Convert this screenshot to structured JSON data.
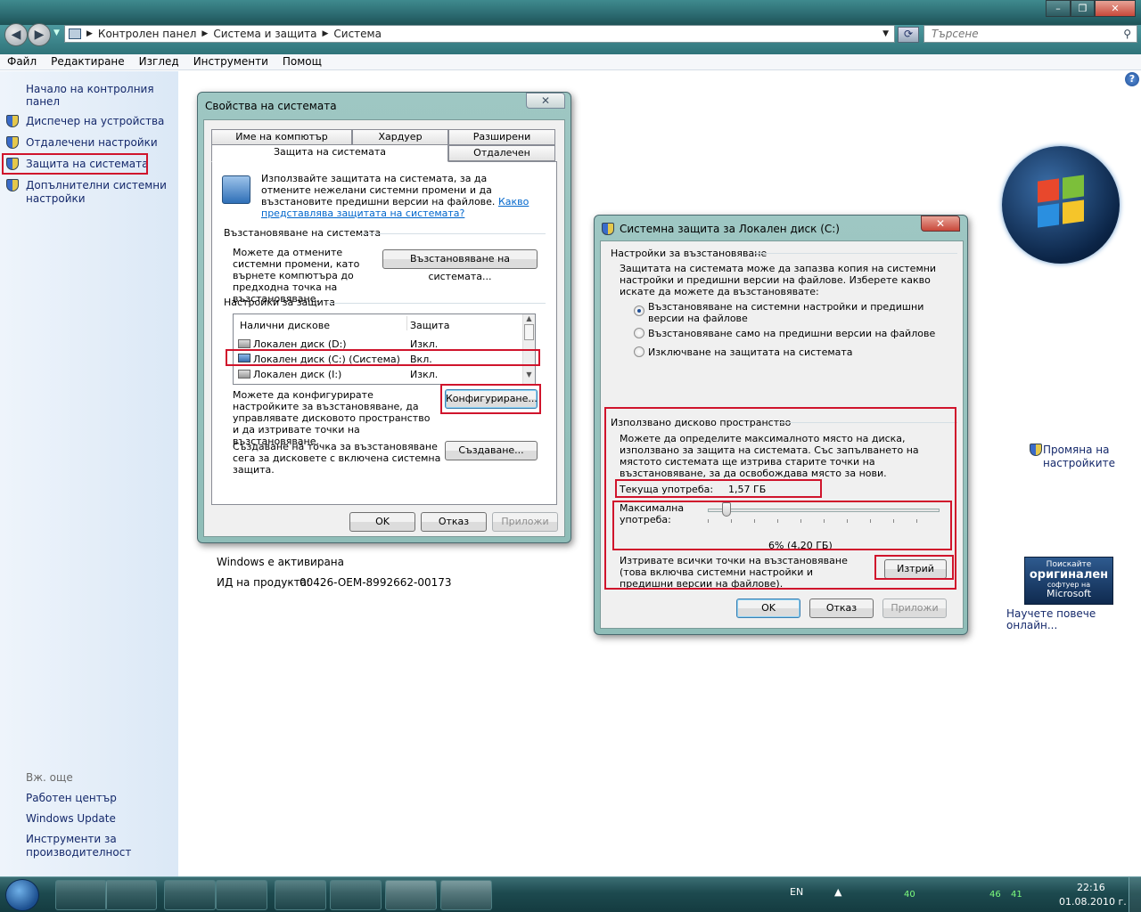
{
  "address": {
    "crumbs": [
      "Контролен панел",
      "Система и защита",
      "Система"
    ],
    "search_placeholder": "Търсене"
  },
  "window_buttons": [
    "–",
    "❐",
    "✕"
  ],
  "menu": [
    "Файл",
    "Редактиране",
    "Изглед",
    "Инструменти",
    "Помощ"
  ],
  "left_pane": {
    "home": "Начало на контролния панел",
    "items": [
      "Диспечер на устройства",
      "Отдалечени настройки",
      "Защита на системата",
      "Допълнителни системни настройки"
    ],
    "see_also": "Вж. още",
    "see_also_items": [
      "Работен център",
      "Windows Update",
      "Инструменти за производителност"
    ]
  },
  "main": {
    "activated": "Windows е активирана",
    "product_id_label": "ИД на продукта:",
    "product_id": "00426-OEM-8992662-00173",
    "change_settings": "Промяна на настройките",
    "genuine_line1": "Поискайте",
    "genuine_line2": "оригинален",
    "genuine_line3": "софтуер на",
    "genuine_line4": "Microsoft",
    "learn_more": "Научете повече онлайн..."
  },
  "sysprops": {
    "title": "Свойства на системата",
    "tabs": [
      "Име на компютър",
      "Хардуер",
      "Разширени",
      "Защита на системата",
      "Отдалечен"
    ],
    "intro": "Използвайте защитата на системата, за да отмените нежелани системни промени и да възстановите предишни версии на файлове.",
    "intro_link": "Какво представлява защитата на системата?",
    "restore_group": "Възстановяване на системата",
    "restore_text": "Можете да отмените системни промени, като върнете компютъра до предходна точка на възстановяване.",
    "restore_button": "Възстановяване на системата...",
    "protect_group": "Настройки за защита",
    "col_drives": "Налични дискове",
    "col_protection": "Защита",
    "drives": [
      {
        "name": "Локален диск (D:)",
        "state": "Изкл."
      },
      {
        "name": "Локален диск (C:) (Система)",
        "state": "Вкл."
      },
      {
        "name": "Локален диск (I:)",
        "state": "Изкл."
      }
    ],
    "configure_text": "Можете да конфигурирате настройките за възстановяване, да управлявате дисковото пространство и да изтривате точки на възстановяване.",
    "configure_button": "Конфигуриране...",
    "create_text": "Създаване на точка за възстановяване сега за дисковете с включена системна защита.",
    "create_button": "Създаване...",
    "ok": "OK",
    "cancel": "Отказ",
    "apply": "Приложи"
  },
  "protect_dlg": {
    "title": "Системна защита за Локален диск (C:)",
    "restore_group": "Настройки за възстановяване",
    "restore_text": "Защитата на системата може да запазва копия на системни настройки и предишни версии на файлове. Изберете какво искате да можете да възстановявате:",
    "options": [
      "Възстановяване на системни настройки и предишни версии на файлове",
      "Възстановяване само на предишни версии на файлове",
      "Изключване на защитата на системата"
    ],
    "selected_option": 0,
    "disk_group": "Използвано дисково пространство",
    "disk_text": "Можете да определите максималното място на диска, използвано за защита на системата. Със запълването на мястото системата ще изтрива старите точки на възстановяване, за да освобождава място за нови.",
    "current_label": "Текуща употреба:",
    "current_value": "1,57 ГБ",
    "max_label": "Максимална употреба:",
    "max_value": "6% (4,20 ГБ)",
    "max_percent": 6,
    "delete_text": "Изтривате всички точки на възстановяване (това включва системни настройки и предишни версии на файлове).",
    "delete_button": "Изтрий",
    "ok": "OK",
    "cancel": "Отказ",
    "apply": "Приложи"
  },
  "taskbar": {
    "lang": "EN",
    "tray_values": [
      "40",
      "46",
      "41"
    ],
    "time": "22:16",
    "date": "01.08.2010 г."
  }
}
